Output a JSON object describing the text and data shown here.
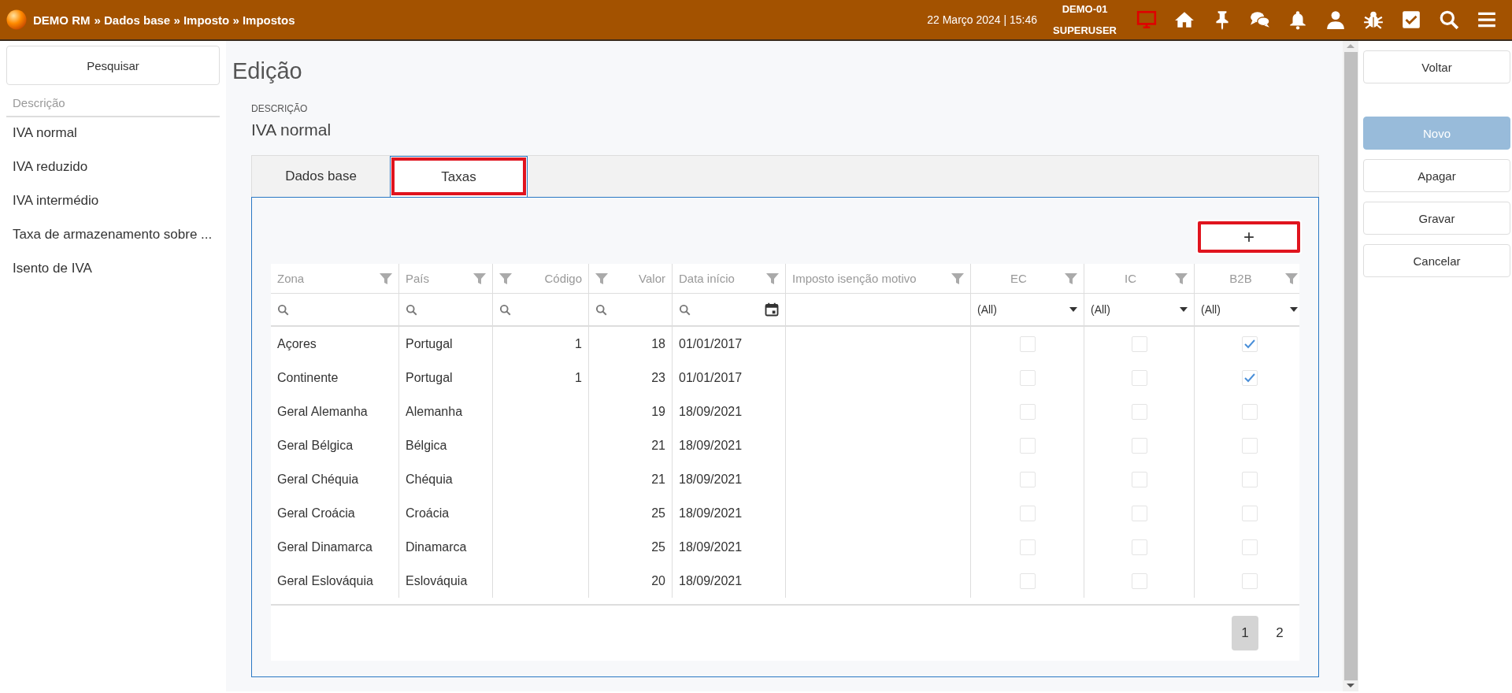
{
  "header": {
    "app": "DEMO RM",
    "breadcrumb": "» Dados base » Imposto » Impostos",
    "datetime": "22 Março 2024 | 15:46",
    "company": "DEMO-01",
    "user": "SUPERUSER"
  },
  "sidebar": {
    "search_button": "Pesquisar",
    "column": "Descrição",
    "items": [
      {
        "label": "IVA normal",
        "selected": false
      },
      {
        "label": "IVA reduzido",
        "selected": false
      },
      {
        "label": "IVA intermédio",
        "selected": false
      },
      {
        "label": "Taxa de armazenamento sobre ...",
        "selected": false
      },
      {
        "label": "Isento de IVA",
        "selected": false
      }
    ]
  },
  "page_title": "Edição",
  "field": {
    "label": "DESCRIÇÃO",
    "value": "IVA normal"
  },
  "tabs": [
    {
      "label": "Dados base",
      "selected": false,
      "highlighted": false
    },
    {
      "label": "Taxas",
      "selected": true,
      "highlighted": true
    }
  ],
  "add_button": {
    "label": "+",
    "highlighted": true
  },
  "table": {
    "columns": [
      {
        "label": "Zona",
        "kind": "text"
      },
      {
        "label": "País",
        "kind": "text"
      },
      {
        "label": "Código",
        "kind": "number"
      },
      {
        "label": "Valor",
        "kind": "number"
      },
      {
        "label": "Data início",
        "kind": "date"
      },
      {
        "label": "Imposto isenção motivo",
        "kind": "memo"
      },
      {
        "label": "EC",
        "kind": "flag",
        "filter_value": "(All)"
      },
      {
        "label": "IC",
        "kind": "flag",
        "filter_value": "(All)"
      },
      {
        "label": "B2B",
        "kind": "flag",
        "filter_value": "(All)"
      }
    ],
    "rows": [
      {
        "zona": "Açores",
        "pais": "Portugal",
        "codigo": "1",
        "valor": "18",
        "data": "01/01/2017",
        "ec": false,
        "ic": false,
        "b2b": true
      },
      {
        "zona": "Continente",
        "pais": "Portugal",
        "codigo": "1",
        "valor": "23",
        "data": "01/01/2017",
        "ec": false,
        "ic": false,
        "b2b": true
      },
      {
        "zona": "Geral Alemanha",
        "pais": "Alemanha",
        "valor": "19",
        "data": "18/09/2021",
        "ec": false,
        "ic": false,
        "b2b": false
      },
      {
        "zona": "Geral Bélgica",
        "pais": "Bélgica",
        "valor": "21",
        "data": "18/09/2021",
        "ec": false,
        "ic": false,
        "b2b": false
      },
      {
        "zona": "Geral Chéquia",
        "pais": "Chéquia",
        "valor": "21",
        "data": "18/09/2021",
        "ec": false,
        "ic": false,
        "b2b": false
      },
      {
        "zona": "Geral Croácia",
        "pais": "Croácia",
        "valor": "25",
        "data": "18/09/2021",
        "ec": false,
        "ic": false,
        "b2b": false
      },
      {
        "zona": "Geral Dinamarca",
        "pais": "Dinamarca",
        "valor": "25",
        "data": "18/09/2021",
        "ec": false,
        "ic": false,
        "b2b": false
      },
      {
        "zona": "Geral Eslováquia",
        "pais": "Eslováquia",
        "valor": "20",
        "data": "18/09/2021",
        "ec": false,
        "ic": false,
        "b2b": false
      }
    ],
    "pages": [
      {
        "label": "1",
        "selected": true
      },
      {
        "label": "2",
        "selected": false
      }
    ]
  },
  "actions": [
    {
      "label": "Voltar",
      "disabled": false,
      "primary": false
    },
    {
      "label": "Novo",
      "disabled": true,
      "primary": true
    },
    {
      "label": "Apagar",
      "disabled": false,
      "primary": false
    },
    {
      "label": "Gravar",
      "disabled": false,
      "primary": false
    },
    {
      "label": "Cancelar",
      "disabled": false,
      "primary": false
    }
  ]
}
